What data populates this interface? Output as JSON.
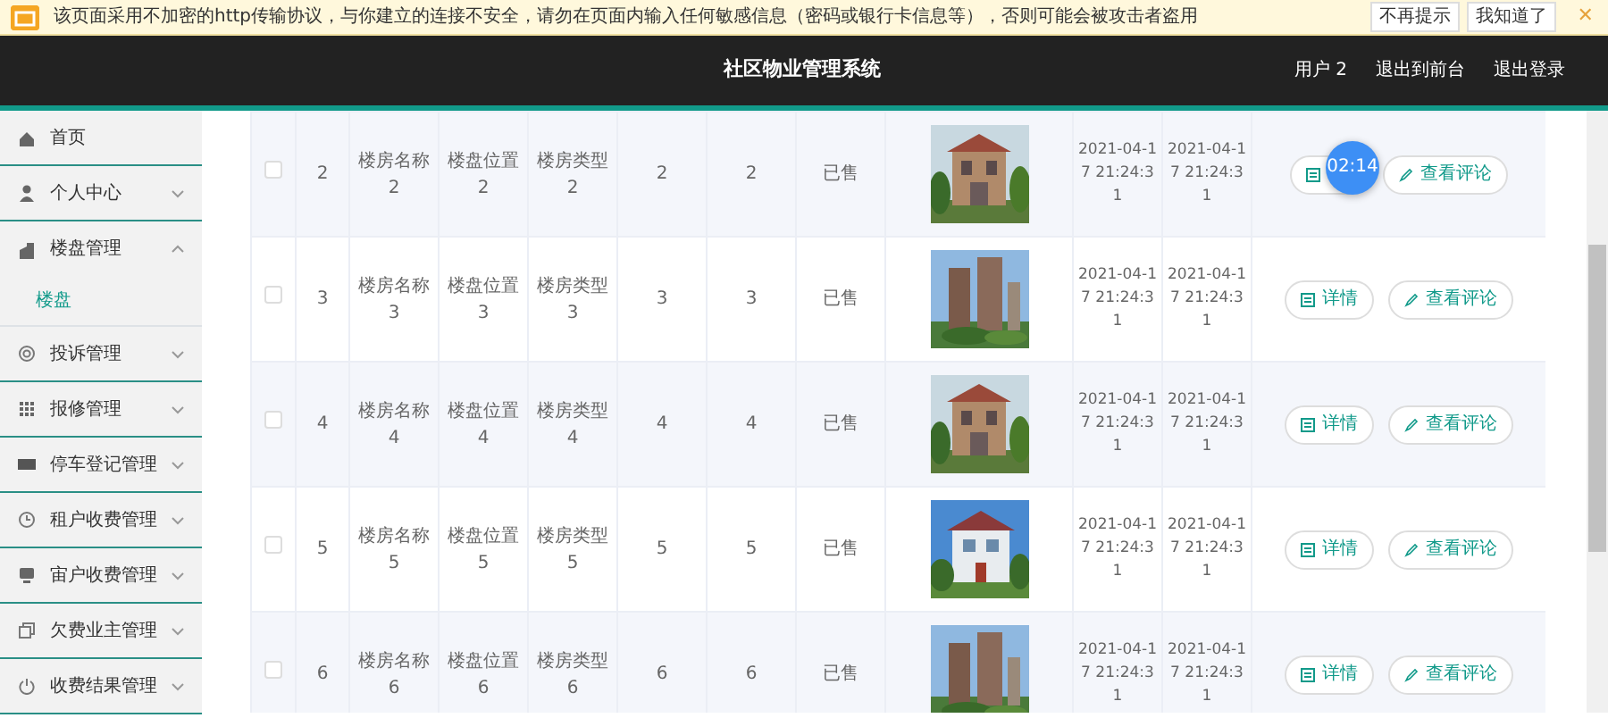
{
  "warning_bar": {
    "message": "该页面采用不加密的http传输协议，与你建立的连接不安全，请勿在页面内输入任何敏感信息（密码或银行卡信息等），否则可能会被攻击者盗用",
    "buttons": [
      "不再提示",
      "我知道了"
    ],
    "close": "✕"
  },
  "header": {
    "title": "社区物业管理系统",
    "links": [
      "用户 2",
      "退出到前台",
      "退出登录"
    ]
  },
  "sidebar": {
    "items": [
      {
        "label": "首页",
        "kind": "link"
      },
      {
        "label": "个人中心",
        "kind": "menu",
        "expanded": false
      },
      {
        "label": "楼盘管理",
        "kind": "menu",
        "expanded": true,
        "children": [
          {
            "label": "楼盘"
          }
        ]
      },
      {
        "label": "投诉管理",
        "kind": "menu",
        "expanded": false
      },
      {
        "label": "报修管理",
        "kind": "menu",
        "expanded": false
      },
      {
        "label": "停车登记管理",
        "kind": "menu",
        "expanded": false
      },
      {
        "label": "租户收费管理",
        "kind": "menu",
        "expanded": false
      },
      {
        "label": "宙户收费管理",
        "kind": "menu",
        "expanded": false
      },
      {
        "label": "欠费业主管理",
        "kind": "menu",
        "expanded": false
      },
      {
        "label": "收费结果管理",
        "kind": "menu",
        "expanded": false
      }
    ]
  },
  "table": {
    "rows": [
      {
        "checked": false,
        "cells": [
          "2",
          "楼房名称2",
          "楼盘位置2",
          "楼房类型2",
          "2",
          "2",
          "已售"
        ],
        "dates": [
          "2021-04-17 21:24:31",
          "2021-04-17 21:24:31"
        ],
        "actions": [
          {
            "kind": "detail"
          },
          {
            "kind": "comment",
            "label": "查看评论"
          }
        ]
      },
      {
        "checked": false,
        "cells": [
          "3",
          "楼房名称3",
          "楼盘位置3",
          "楼房类型3",
          "3",
          "3",
          "已售"
        ],
        "dates": [
          "2021-04-17 21:24:31",
          "2021-04-17 21:24:31"
        ],
        "actions": [
          {
            "kind": "detail",
            "label": "详情"
          },
          {
            "kind": "comment",
            "label": "查看评论"
          }
        ]
      },
      {
        "checked": false,
        "cells": [
          "4",
          "楼房名称4",
          "楼盘位置4",
          "楼房类型4",
          "4",
          "4",
          "已售"
        ],
        "dates": [
          "2021-04-17 21:24:31",
          "2021-04-17 21:24:31"
        ],
        "actions": [
          {
            "kind": "detail",
            "label": "详情"
          },
          {
            "kind": "comment",
            "label": "查看评论"
          }
        ]
      },
      {
        "checked": false,
        "cells": [
          "5",
          "楼房名称5",
          "楼盘位置5",
          "楼房类型5",
          "5",
          "5",
          "已售"
        ],
        "dates": [
          "2021-04-17 21:24:31",
          "2021-04-17 21:24:31"
        ],
        "actions": [
          {
            "kind": "detail",
            "label": "详情"
          },
          {
            "kind": "comment",
            "label": "查看评论"
          }
        ]
      },
      {
        "checked": false,
        "cells": [
          "6",
          "楼房名称6",
          "楼盘位置6",
          "楼房类型6",
          "6",
          "6",
          "已售"
        ],
        "dates": [
          "2021-04-17 21:24:31",
          "2021-04-17 21:24:31"
        ],
        "actions": [
          {
            "kind": "detail",
            "label": "详情"
          },
          {
            "kind": "comment",
            "label": "查看评论"
          }
        ]
      }
    ]
  },
  "timer_badge": "02:14"
}
